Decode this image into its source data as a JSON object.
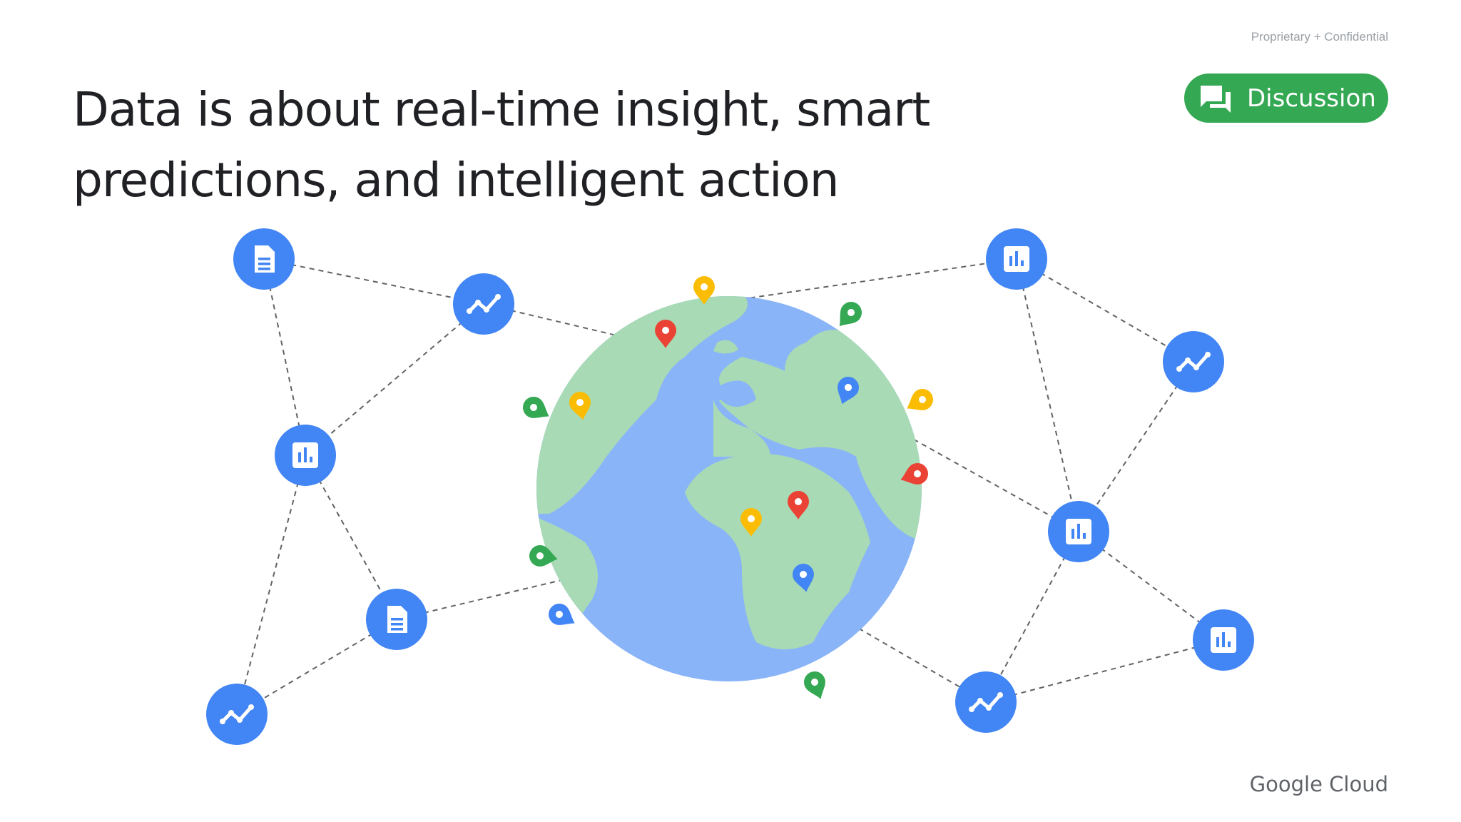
{
  "header": {
    "confidential_label": "Proprietary + Confidential",
    "title_line1": "Data is about real-time insight, smart",
    "title_line2": "predictions, and intelligent action"
  },
  "badge": {
    "label": "Discussion",
    "icon": "discussion-icon",
    "color": "#34a853"
  },
  "footer": {
    "logo_text": "Google Cloud"
  },
  "illustration": {
    "globe": {
      "ocean_color": "#8ab4f8",
      "land_color": "#a8dab5"
    },
    "node_color": "#4285f4",
    "node_icons": [
      "document-icon",
      "trend-line-icon",
      "bar-chart-icon"
    ],
    "pin_colors": {
      "red": "#ea4335",
      "yellow": "#fbbc04",
      "green": "#34a853",
      "blue": "#4285f4"
    }
  }
}
